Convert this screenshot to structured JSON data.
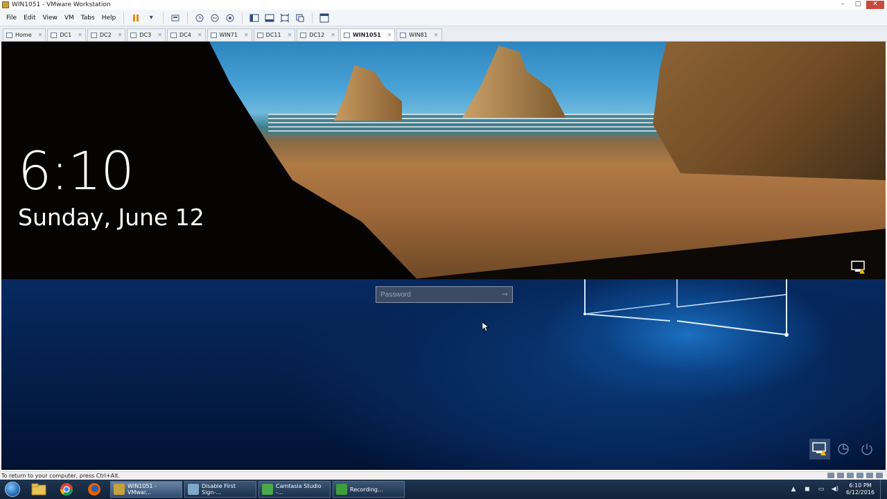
{
  "window": {
    "title": "WIN1051 - VMware Workstation",
    "controls": {
      "minimize": "–",
      "maximize": "□",
      "close": "✕"
    }
  },
  "menu": {
    "items": [
      "File",
      "Edit",
      "View",
      "VM",
      "Tabs",
      "Help"
    ]
  },
  "tabs": [
    {
      "label": "Home",
      "active": false
    },
    {
      "label": "DC1",
      "active": false
    },
    {
      "label": "DC2",
      "active": false
    },
    {
      "label": "DC3",
      "active": false
    },
    {
      "label": "DC4",
      "active": false
    },
    {
      "label": "WIN71",
      "active": false
    },
    {
      "label": "DC11",
      "active": false
    },
    {
      "label": "DC12",
      "active": false
    },
    {
      "label": "WIN1051",
      "active": true
    },
    {
      "label": "WIN81",
      "active": false
    }
  ],
  "lockscreen": {
    "time": "6:10",
    "date": "Sunday, June 12",
    "password_placeholder": "Password",
    "submit_glyph": "→",
    "bottom_icons": [
      "network-icon",
      "ease-of-access-icon",
      "power-icon"
    ]
  },
  "statusbar": {
    "text": "To return to your computer, press Ctrl+Alt."
  },
  "taskbar": {
    "pinned": [
      "windows-explorer-icon",
      "chrome-icon",
      "firefox-icon"
    ],
    "buttons": [
      {
        "label": "WIN1051 - VMwar...",
        "active": true,
        "icon_color": "#c7a23c"
      },
      {
        "label": "Disable First Sign-...",
        "active": false,
        "icon_color": "#7fa8c9"
      },
      {
        "label": "Camtasia Studio -...",
        "active": false,
        "icon_color": "#4aa84a"
      },
      {
        "label": "Recording...",
        "active": false,
        "icon_color": "#3e9d3e"
      }
    ],
    "clock_time": "6:10 PM",
    "clock_date": "6/12/2016"
  },
  "colors": {
    "lock_bottom": "#062a60",
    "taskbar": "#1a2d45",
    "accent_pause": "#e28a17"
  }
}
